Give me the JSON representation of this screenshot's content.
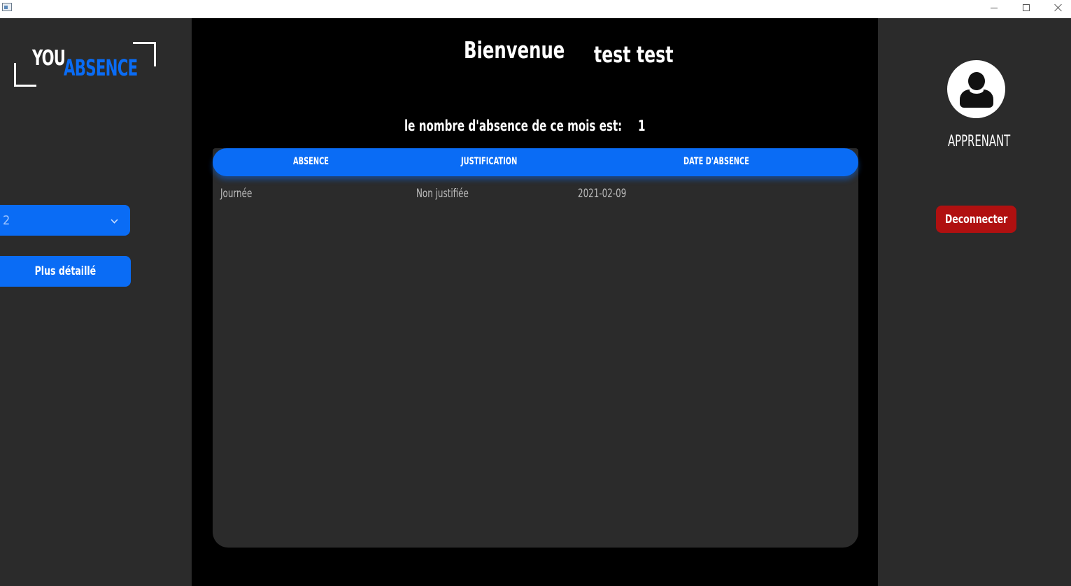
{
  "logo": {
    "part1": "YOU",
    "part2": "ABSENCE"
  },
  "sidebar": {
    "month_select_value": "2",
    "detail_button_label": "Plus détaillé"
  },
  "main": {
    "welcome": "Bienvenue",
    "username": "test test",
    "absence_count_label": "le nombre d'absence de ce mois est:",
    "absence_count_value": "1",
    "table": {
      "columns": [
        "ABSENCE",
        "JUSTIFICATION",
        "DATE D'ABSENCE"
      ],
      "rows": [
        {
          "absence": "Journée",
          "justification": "Non justifiée",
          "date": "2021-02-09"
        }
      ]
    }
  },
  "user_panel": {
    "role": "APPRENANT",
    "logout_label": "Deconnecter"
  },
  "colors": {
    "accent": "#0a6cf5",
    "danger": "#b01010",
    "panel_bg": "#2b2b2b",
    "main_bg": "#000000"
  },
  "icons": {
    "avatar": "user-avatar-icon",
    "dropdown": "chevron-down-icon"
  }
}
